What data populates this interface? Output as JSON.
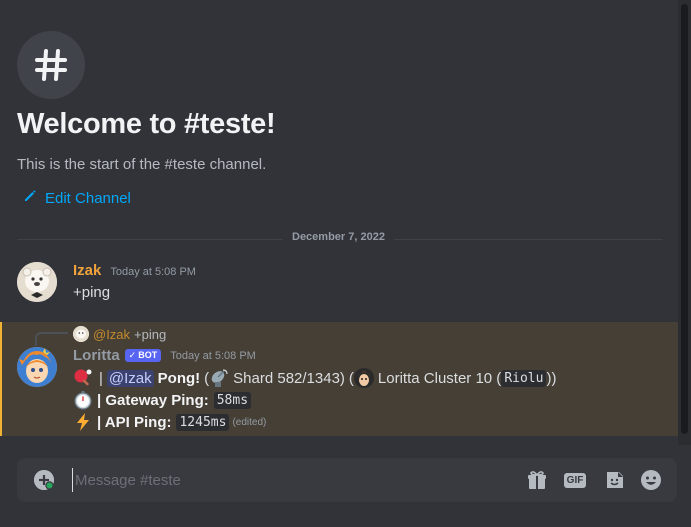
{
  "channel": {
    "icon": "hashtag-icon",
    "welcome_title": "Welcome to #teste!",
    "welcome_subtitle": "This is the start of the #teste channel.",
    "edit_label": "Edit Channel",
    "edit_icon": "pencil-icon"
  },
  "date_divider": "December 7, 2022",
  "messages": [
    {
      "author": "Izak",
      "author_color": "#f0a23c",
      "timestamp": "Today at 5:08 PM",
      "content": "+ping"
    },
    {
      "reply": {
        "mention": "@Izak",
        "text": "+ping"
      },
      "author": "Loritta",
      "author_color": "#949ba4",
      "bot_tag": "BOT",
      "timestamp": "Today at 5:08 PM",
      "lines": {
        "line1": {
          "separator": "|",
          "mention": "@Izak",
          "pong": "Pong!",
          "open_paren": "(",
          "shard": "Shard 582/1343)",
          "open_paren2": "(",
          "cluster": "Loritta Cluster 10 (",
          "cluster_code": "Riolu",
          "close": "))"
        },
        "line2": {
          "label": "| Gateway Ping:",
          "value": "58ms"
        },
        "line3": {
          "label": "| API Ping:",
          "value": "1245ms",
          "edited": "(edited)"
        }
      }
    }
  ],
  "composer": {
    "placeholder": "Message #teste",
    "gif_label": "GIF",
    "icons": [
      "add-circle-icon",
      "gift-icon",
      "gif-icon",
      "sticker-icon",
      "emoji-icon"
    ]
  }
}
